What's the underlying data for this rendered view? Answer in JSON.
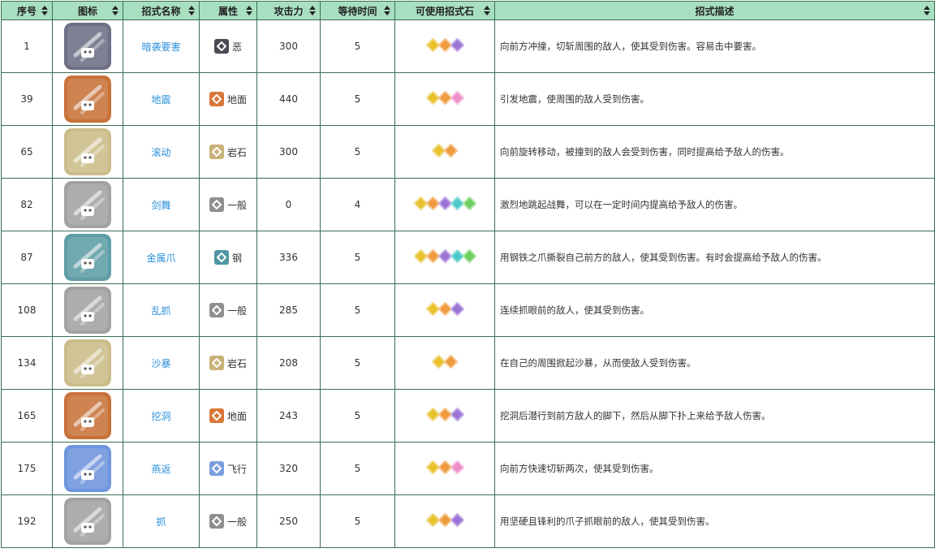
{
  "headers": [
    "序号",
    "图标",
    "招式名称",
    "属性",
    "攻击力",
    "等待时间",
    "可使用招式石",
    "招式描述"
  ],
  "colors": {
    "header_bg": "#a8dfc1",
    "border": "#3a6f52",
    "link": "#2b8fd9",
    "gem_yellow": "#e8c12c",
    "gem_orange": "#ef9a3c",
    "gem_purple": "#9b74d6",
    "gem_pink": "#ee8fc9",
    "gem_cyan": "#4ec9c9",
    "gem_green": "#6dcf5e"
  },
  "rows": [
    {
      "no": "1",
      "name": "暗袭要害",
      "type": "恶",
      "type_color": "#4a4a55",
      "icon_color": "#6f6f86",
      "attack": "300",
      "wait": "5",
      "gems": [
        "yellow",
        "orange",
        "purple"
      ],
      "desc": "向前方冲撞，切斩周围的敌人，使其受到伤害。容易击中要害。"
    },
    {
      "no": "39",
      "name": "地震",
      "type": "地面",
      "type_color": "#d9773a",
      "icon_color": "#c8723a",
      "attack": "440",
      "wait": "5",
      "gems": [
        "yellow",
        "orange",
        "pink"
      ],
      "desc": "引发地震，使周围的敌人受到伤害。"
    },
    {
      "no": "65",
      "name": "滚动",
      "type": "岩石",
      "type_color": "#c9b27a",
      "icon_color": "#cbbd8a",
      "attack": "300",
      "wait": "5",
      "gems": [
        "yellow",
        "orange"
      ],
      "desc": "向前旋转移动，被撞到的敌人会受到伤害，同时提高给予敌人的伤害。"
    },
    {
      "no": "82",
      "name": "剑舞",
      "type": "一般",
      "type_color": "#8f8f8f",
      "icon_color": "#a2a2a2",
      "attack": "0",
      "wait": "4",
      "gems": [
        "yellow",
        "orange",
        "purple",
        "cyan",
        "green"
      ],
      "desc": "激烈地跳起战舞，可以在一定时间内提高给予敌人的伤害。"
    },
    {
      "no": "87",
      "name": "金属爪",
      "type": "钢",
      "type_color": "#4f96a2",
      "icon_color": "#5e9ea6",
      "attack": "336",
      "wait": "5",
      "gems": [
        "yellow",
        "orange",
        "purple",
        "cyan",
        "green"
      ],
      "desc": "用钢铁之爪撕裂自己前方的敌人，使其受到伤害。有时会提高给予敌人的伤害。"
    },
    {
      "no": "108",
      "name": "乱抓",
      "type": "一般",
      "type_color": "#8f8f8f",
      "icon_color": "#a2a2a2",
      "attack": "285",
      "wait": "5",
      "gems": [
        "yellow",
        "orange",
        "purple"
      ],
      "desc": "连续抓眼前的敌人，使其受到伤害。"
    },
    {
      "no": "134",
      "name": "沙暴",
      "type": "岩石",
      "type_color": "#c9b27a",
      "icon_color": "#cbbd8a",
      "attack": "208",
      "wait": "5",
      "gems": [
        "yellow",
        "orange"
      ],
      "desc": "在自己的周围掀起沙暴，从而使敌人受到伤害。"
    },
    {
      "no": "165",
      "name": "挖洞",
      "type": "地面",
      "type_color": "#d9773a",
      "icon_color": "#c8723a",
      "attack": "243",
      "wait": "5",
      "gems": [
        "yellow",
        "orange",
        "purple"
      ],
      "desc": "挖洞后潜行到前方敌人的脚下，然后从脚下扑上来给予敌人伤害。"
    },
    {
      "no": "175",
      "name": "燕返",
      "type": "飞行",
      "type_color": "#7b9fe0",
      "icon_color": "#6f95dc",
      "attack": "320",
      "wait": "5",
      "gems": [
        "yellow",
        "orange",
        "pink"
      ],
      "desc": "向前方快速切斩两次，使其受到伤害。"
    },
    {
      "no": "192",
      "name": "抓",
      "type": "一般",
      "type_color": "#8f8f8f",
      "icon_color": "#a2a2a2",
      "attack": "250",
      "wait": "5",
      "gems": [
        "yellow",
        "orange",
        "purple"
      ],
      "desc": "用坚硬且锋利的爪子抓眼前的敌人，使其受到伤害。"
    }
  ]
}
